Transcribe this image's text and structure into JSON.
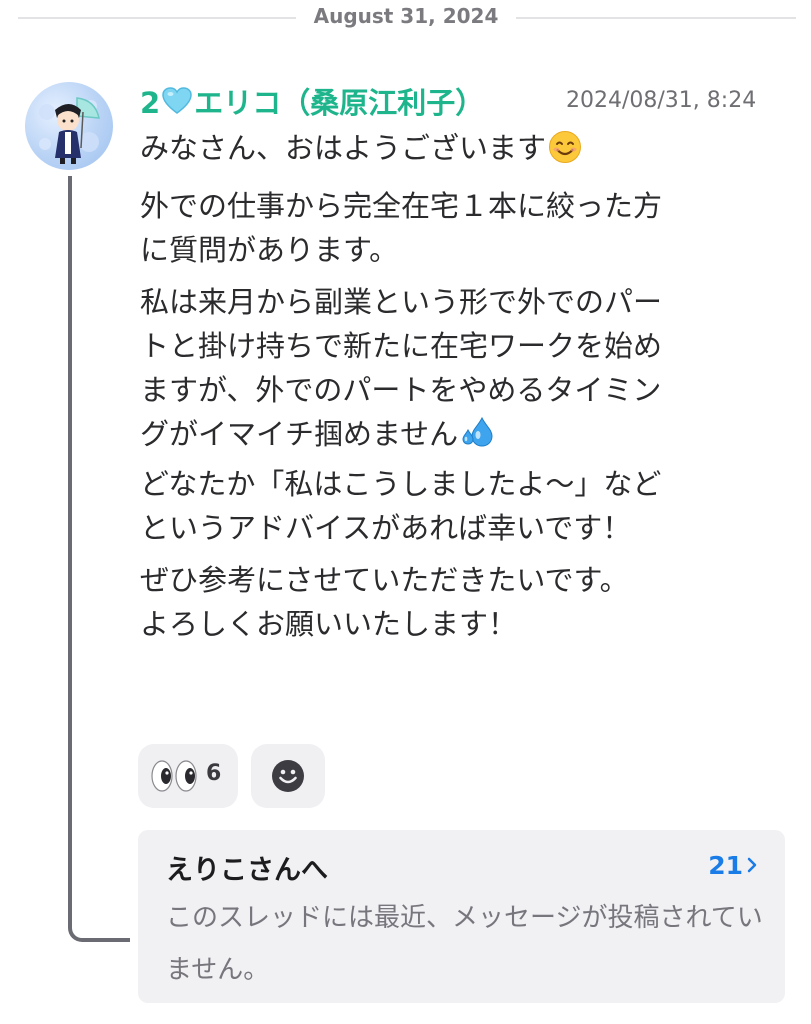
{
  "date_divider": "August 31, 2024",
  "message": {
    "author_prefix": "2",
    "author_name": "エリコ（桑原江利子）",
    "timestamp": "2024/08/31, 8:24",
    "lines": [
      "みなさん、おはようございます",
      "外での仕事から完全在宅１本に絞った方",
      "に質問があります。",
      "私は来月から副業という形で外でのパー",
      "トと掛け持ちで新たに在宅ワークを始め",
      "ますが、外でのパートをやめるタイミン",
      "グがイマイチ掴めません",
      "どなたか「私はこうしましたよ〜」など",
      "というアドバイスがあれば幸いです！",
      "ぜひ参考にさせていただきたいです。",
      "よろしくお願いいたします！"
    ],
    "icons": {
      "author_heart": "light-blue-heart-icon",
      "smile": "smiling-face-icon",
      "sweat": "sweat-droplets-icon"
    }
  },
  "reactions": [
    {
      "icon": "eyes-icon",
      "count": "6"
    }
  ],
  "add_reaction_icon": "smiley-add-reaction-icon",
  "thread": {
    "title": "えりこさんへ",
    "count": "21",
    "preview": "このスレッドには最近、メッセージが投稿されていません。"
  },
  "colors": {
    "author": "#1fb58c",
    "thread_count": "#1a7ce6",
    "card_bg": "#f1f1f4"
  }
}
